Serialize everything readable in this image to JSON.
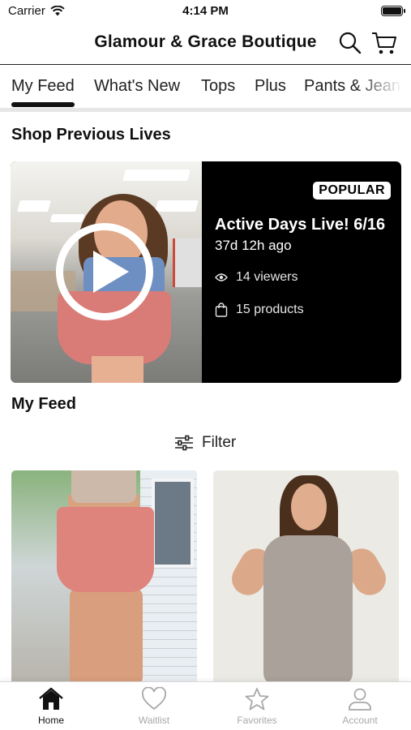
{
  "status_bar": {
    "carrier": "Carrier",
    "time": "4:14 PM"
  },
  "header": {
    "title": "Glamour & Grace Boutique"
  },
  "tabs": [
    {
      "label": "My Feed",
      "active": true
    },
    {
      "label": "What's New"
    },
    {
      "label": "Tops"
    },
    {
      "label": "Plus"
    },
    {
      "label": "Pants & Jeans"
    }
  ],
  "sections": {
    "previous_lives": "Shop Previous Lives",
    "my_feed": "My Feed"
  },
  "live": {
    "badge": "POPULAR",
    "title": "Active Days Live! 6/16",
    "ago": "37d 12h ago",
    "viewers": "14 viewers",
    "products": "15 products"
  },
  "filter": {
    "label": "Filter"
  },
  "bottom_nav": [
    {
      "label": "Home",
      "icon": "home-icon",
      "active": true
    },
    {
      "label": "Waitlist",
      "icon": "heart-icon"
    },
    {
      "label": "Favorites",
      "icon": "star-icon"
    },
    {
      "label": "Account",
      "icon": "person-icon"
    }
  ]
}
